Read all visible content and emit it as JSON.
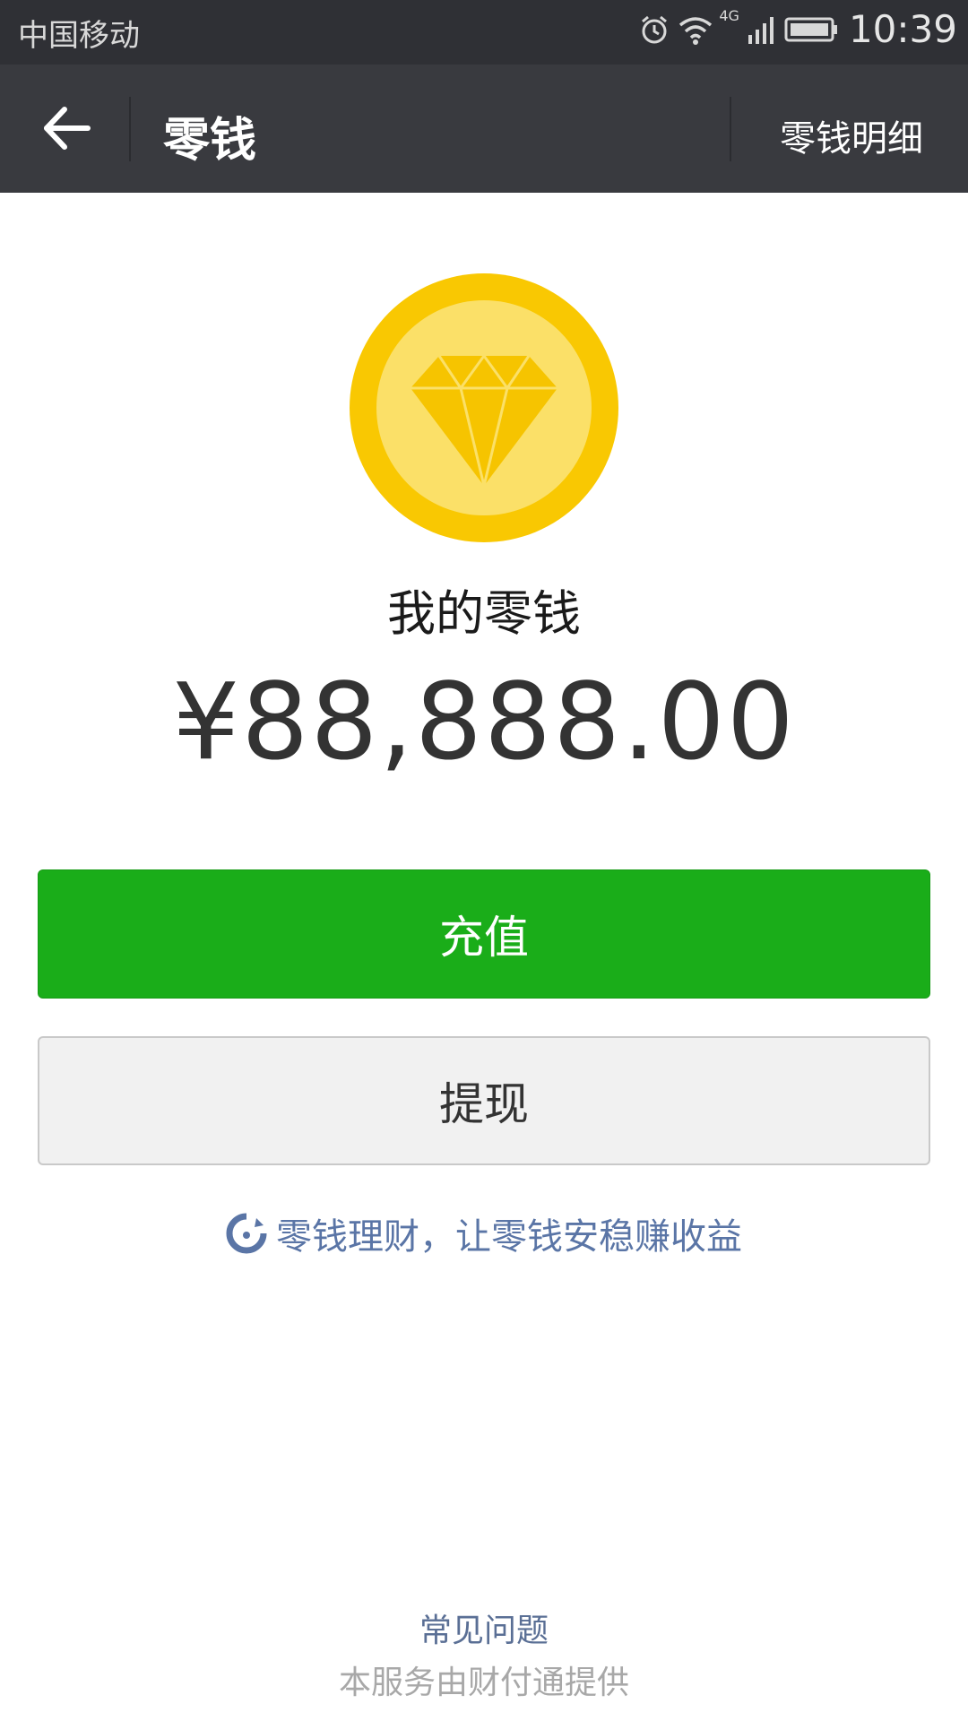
{
  "status_bar": {
    "carrier": "中国移动",
    "network": "4G",
    "time": "10:39",
    "icons": [
      "alarm-icon",
      "wifi-icon",
      "signal-icon",
      "battery-icon"
    ]
  },
  "nav": {
    "title": "零钱",
    "detail_link": "零钱明细"
  },
  "wallet": {
    "label": "我的零钱",
    "balance": "¥88,888.00"
  },
  "actions": {
    "topup_label": "充值",
    "withdraw_label": "提现"
  },
  "promo": {
    "text": "零钱理财，让零钱安稳赚收益"
  },
  "footer": {
    "faq": "常见问题",
    "provider": "本服务由财付通提供"
  },
  "colors": {
    "nav_bg": "#393a3f",
    "primary_green": "#1aad19",
    "coin_outer": "#f9c802",
    "link_blue": "#5a75a6"
  }
}
